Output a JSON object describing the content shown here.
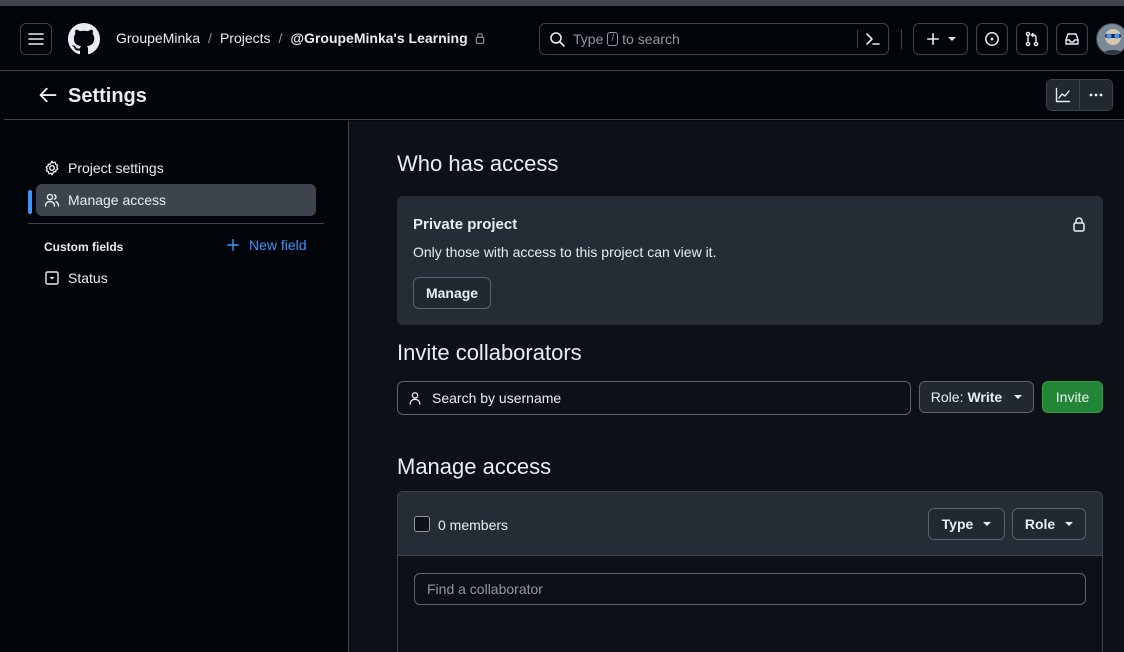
{
  "header": {
    "breadcrumbs": [
      "GroupeMinka",
      "Projects",
      "@GroupeMinka's Learning"
    ],
    "search": {
      "prefix": "Type",
      "key": "/",
      "suffix": "to search"
    }
  },
  "subheader": {
    "title": "Settings"
  },
  "sidebar": {
    "items": [
      {
        "label": "Project settings",
        "icon": "gear-icon"
      },
      {
        "label": "Manage access",
        "icon": "people-icon",
        "active": true
      }
    ],
    "custom_fields_label": "Custom fields",
    "new_field_label": "New field",
    "fields": [
      {
        "label": "Status",
        "icon": "single-select-icon"
      }
    ]
  },
  "main": {
    "who_title": "Who has access",
    "private": {
      "title": "Private project",
      "description": "Only those with access to this project can view it.",
      "manage_label": "Manage"
    },
    "invite_title": "Invite collaborators",
    "invite_placeholder": "Search by username",
    "role_prefix": "Role:",
    "role_value": "Write",
    "invite_label": "Invite",
    "manage_title": "Manage access",
    "members_label": "0 members",
    "type_label": "Type",
    "role_label": "Role",
    "find_placeholder": "Find a collaborator"
  },
  "colors": {
    "accent": "#4493f8",
    "invite_green": "#238636",
    "canvas": "#0d1117",
    "overlay": "#262c36"
  }
}
